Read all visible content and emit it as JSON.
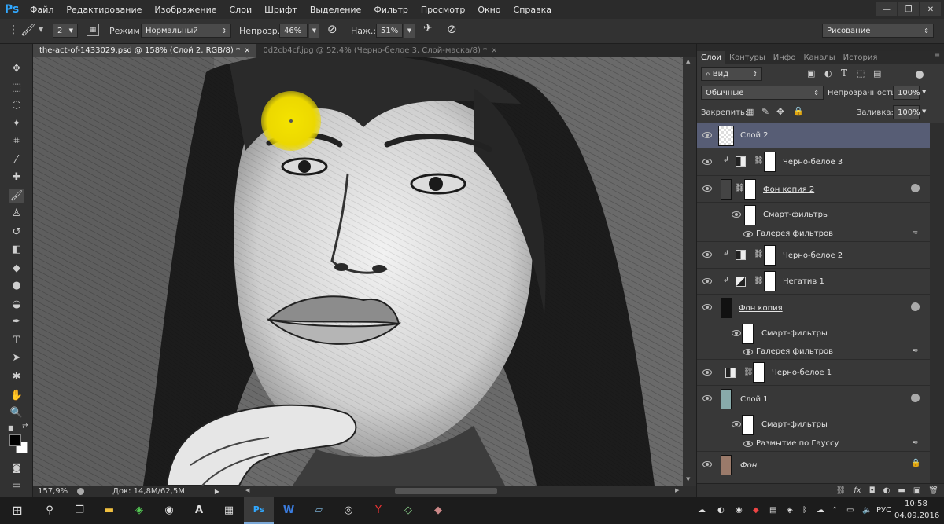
{
  "menubar": {
    "logo": "Ps",
    "items": [
      "Файл",
      "Редактирование",
      "Изображение",
      "Слои",
      "Шрифт",
      "Выделение",
      "Фильтр",
      "Просмотр",
      "Окно",
      "Справка"
    ],
    "window_controls": [
      "—",
      "❐",
      "✕"
    ]
  },
  "options": {
    "brush_size": "2",
    "mode_label": "Режим:",
    "mode_value": "Нормальный",
    "opacity_label": "Непрозр.:",
    "opacity_value": "46%",
    "pressure_label": "Наж.:",
    "pressure_value": "51%",
    "workspace": "Рисование"
  },
  "tabs": [
    {
      "label": "the-act-of-1433029.psd @ 158% (Слой 2, RGB/8) *",
      "close": "×"
    },
    {
      "label": "0d2cb4cf.jpg @ 52,4% (Черно-белое 3, Слой-маска/8) *",
      "close": "×"
    }
  ],
  "statusbar": {
    "zoom": "157,9%",
    "doc_size": "Док: 14,8M/62,5M"
  },
  "panel": {
    "tabs": [
      "Слои",
      "Контуры",
      "Инфо",
      "Каналы",
      "История"
    ],
    "filter_kind": "Вид",
    "blend_mode": "Обычные",
    "opacity_label": "Непрозрачность:",
    "opacity_value": "100%",
    "lock_label": "Закрепить:",
    "fill_label": "Заливка:",
    "fill_value": "100%"
  },
  "layers": [
    {
      "name": "Слой 2"
    },
    {
      "name": "Черно-белое 3"
    },
    {
      "name": "Фон копия 2"
    },
    {
      "name": "Смарт-фильтры"
    },
    {
      "name": "Галерея фильтров"
    },
    {
      "name": "Черно-белое 2"
    },
    {
      "name": "Негатив 1"
    },
    {
      "name": "Фон копия"
    },
    {
      "name": "Смарт-фильтры"
    },
    {
      "name": "Галерея фильтров"
    },
    {
      "name": "Черно-белое 1"
    },
    {
      "name": "Слой 1"
    },
    {
      "name": "Смарт-фильтры"
    },
    {
      "name": "Размытие по Гауссу"
    },
    {
      "name": "Фон"
    }
  ],
  "taskbar": {
    "language": "РУС",
    "time": "10:58",
    "date": "04.09.2016"
  },
  "colors": {
    "selected_layer": "#575d75",
    "brush_cursor": "#f2e000",
    "ps_blue": "#31a8ff"
  }
}
